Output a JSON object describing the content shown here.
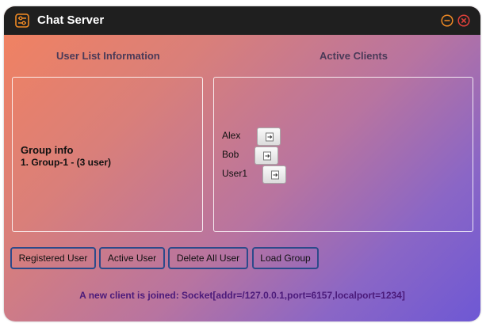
{
  "window": {
    "title": "Chat Server",
    "title_icon": "sliders-icon",
    "minimize_icon": "minimize-icon",
    "close_icon": "close-icon",
    "accent": "#f08a24",
    "background_gradient": [
      "#f3825f",
      "#b874a0",
      "#6e58d4"
    ]
  },
  "user_list": {
    "heading": "User List Information",
    "group_title": "Group info",
    "group_line": "1. Group-1 - (3 user)"
  },
  "active_clients": {
    "heading": "Active Clients",
    "button_icon": "login-arrow-icon",
    "clients": [
      {
        "name": "Alex"
      },
      {
        "name": "Bob"
      },
      {
        "name": "User1"
      }
    ]
  },
  "actions": {
    "registered_user": "Registered User",
    "active_user": "Active User",
    "delete_all_user": "Delete All User",
    "load_group": "Load Group"
  },
  "status": {
    "message": "A new client is joined: Socket[addr=/127.0.0.1,port=6157,localport=1234]"
  }
}
